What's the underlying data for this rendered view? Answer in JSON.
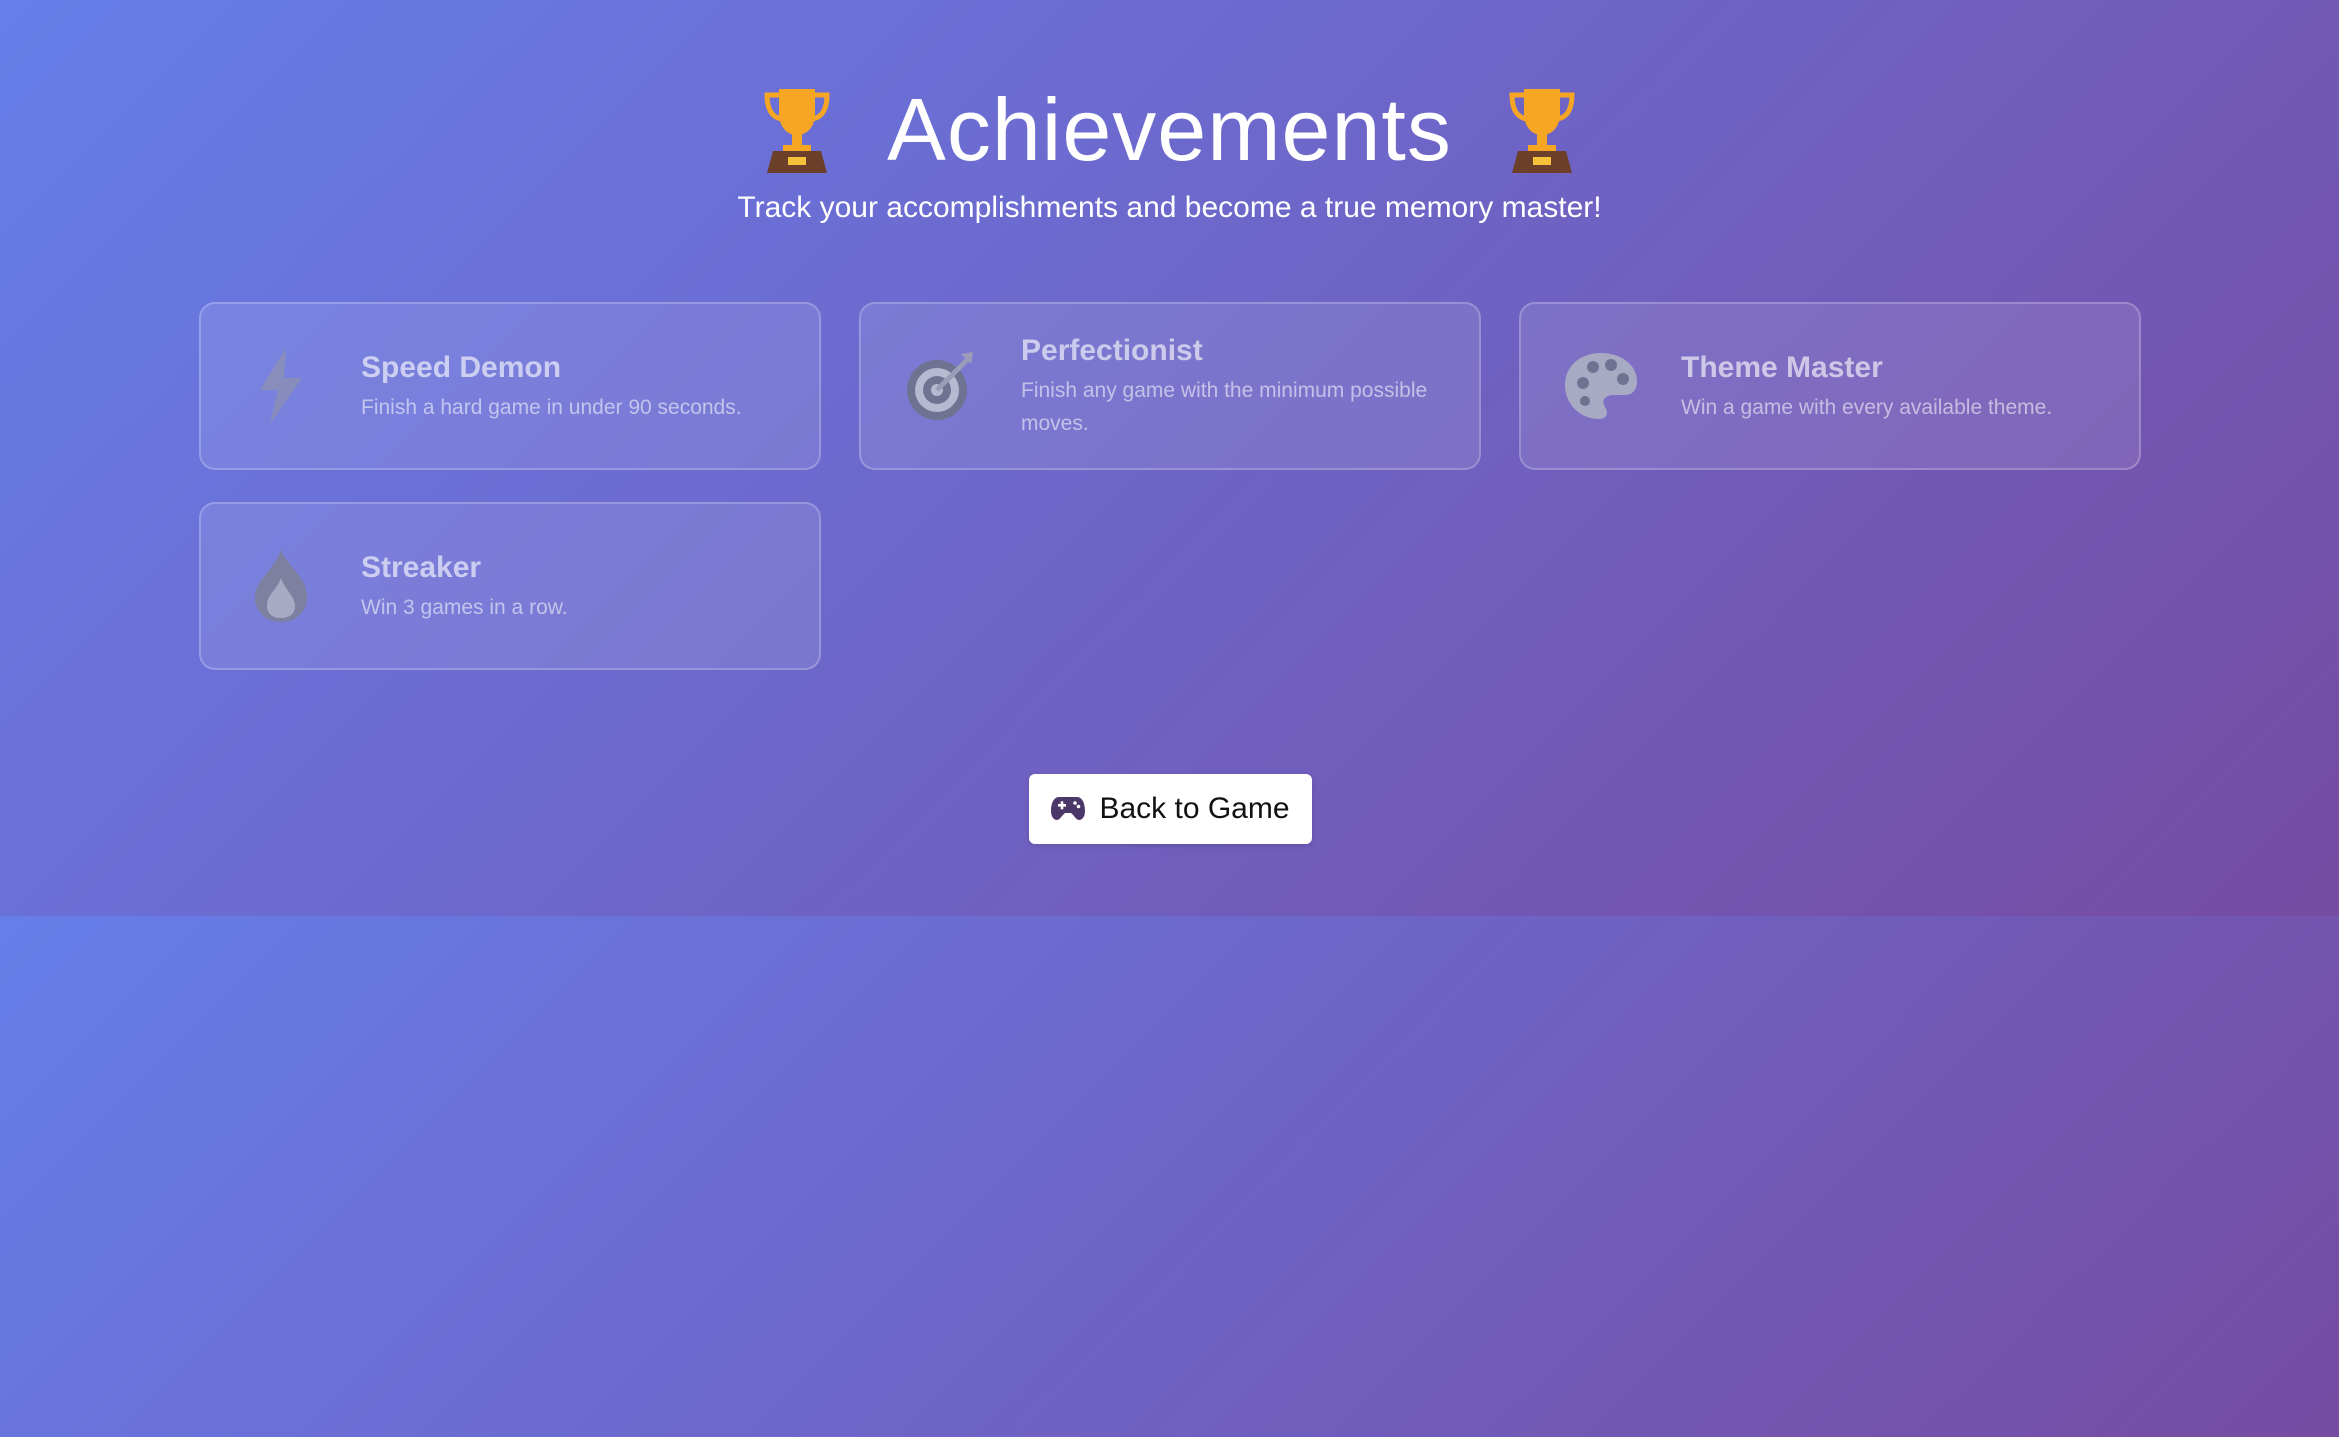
{
  "header": {
    "title": "Achievements",
    "subtitle": "Track your accomplishments and become a true memory master!",
    "trophy_icon": "trophy-icon"
  },
  "achievements": [
    {
      "title": "Speed Demon",
      "description": "Finish a hard game in under 90 seconds.",
      "icon": "lightning-icon",
      "unlocked": false
    },
    {
      "title": "Perfectionist",
      "description": "Finish any game with the minimum possible moves.",
      "icon": "target-icon",
      "unlocked": false
    },
    {
      "title": "Theme Master",
      "description": "Win a game with every available theme.",
      "icon": "palette-icon",
      "unlocked": false
    },
    {
      "title": "Streaker",
      "description": "Win 3 games in a row.",
      "icon": "flame-icon",
      "unlocked": false
    }
  ],
  "back_button": {
    "label": "Back to Game",
    "icon": "gamepad-icon"
  },
  "colors": {
    "gradient_start": "#667eea",
    "gradient_end": "#764ba2",
    "trophy_gold": "#f6a623",
    "trophy_base": "#6b3f2a",
    "locked_icon": "#8d90b0",
    "gamepad": "#4b3768"
  }
}
